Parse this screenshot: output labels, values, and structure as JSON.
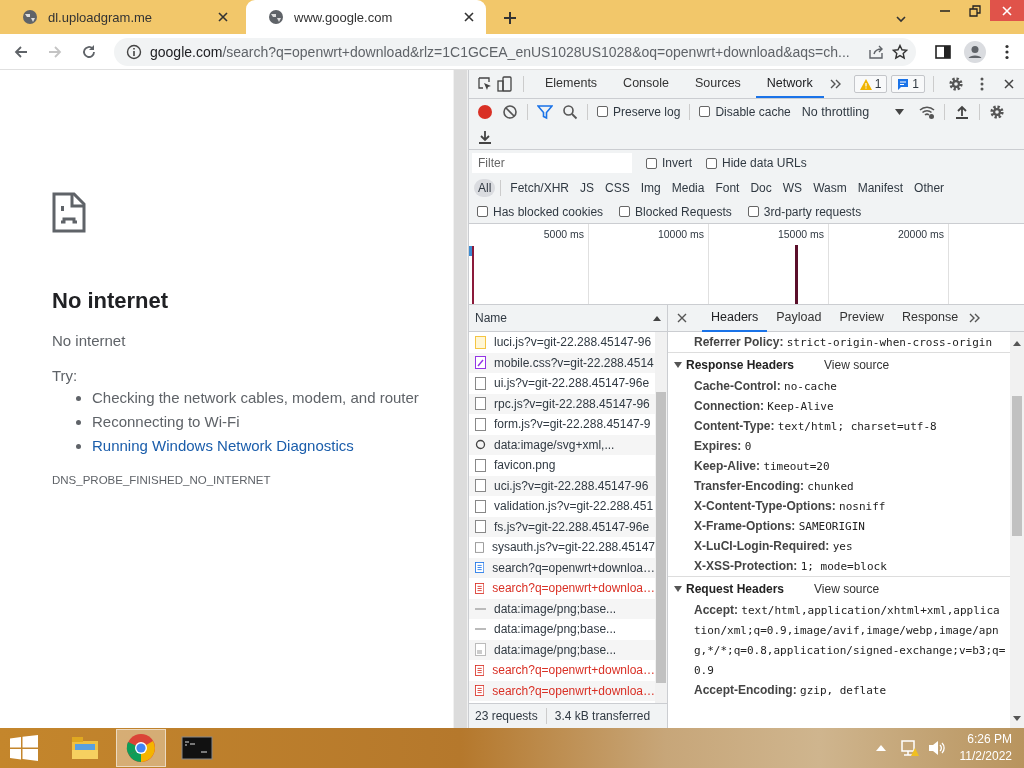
{
  "browser_tabs": [
    {
      "title": "dl.uploadgram.me",
      "selected": false
    },
    {
      "title": "www.google.com",
      "selected": true
    }
  ],
  "toolbar": {
    "nav": [
      {
        "kind": "back",
        "disabled": false
      },
      {
        "kind": "forward",
        "disabled": true
      },
      {
        "kind": "reload",
        "disabled": false
      }
    ],
    "address": {
      "host": "google.com",
      "path": "/search?q=openwrt+download&rlz=1C1GCEA_enUS1028US1028&oq=openwrt+download&aqs=ch..."
    }
  },
  "error_page": {
    "title": "No internet",
    "subtitle": "No internet",
    "try_label": "Try:",
    "suggestions": [
      {
        "kind": "text",
        "text": "Checking the network cables, modem, and router"
      },
      {
        "kind": "text",
        "text": "Reconnecting to Wi-Fi"
      },
      {
        "kind": "link",
        "text": "Running Windows Network Diagnostics"
      }
    ],
    "error_code": "DNS_PROBE_FINISHED_NO_INTERNET"
  },
  "devtools": {
    "tabs": [
      {
        "label": "Elements",
        "selected": false
      },
      {
        "label": "Console",
        "selected": false
      },
      {
        "label": "Sources",
        "selected": false
      },
      {
        "label": "Network",
        "selected": true
      }
    ],
    "warnings": "1",
    "messages": "1",
    "network_toolbar": {
      "recording": true,
      "preserve_log": {
        "label": "Preserve log",
        "checked": false
      },
      "disable_cache": {
        "label": "Disable cache",
        "checked": false
      },
      "throttling": "No throttling"
    },
    "filter": {
      "placeholder": "Filter",
      "options": [
        {
          "label": "Invert",
          "checked": false
        },
        {
          "label": "Hide data URLs",
          "checked": false
        }
      ]
    },
    "type_filters": [
      {
        "label": "All",
        "selected": true
      },
      {
        "label": "Fetch/XHR",
        "selected": false
      },
      {
        "label": "JS",
        "selected": false
      },
      {
        "label": "CSS",
        "selected": false
      },
      {
        "label": "Img",
        "selected": false
      },
      {
        "label": "Media",
        "selected": false
      },
      {
        "label": "Font",
        "selected": false
      },
      {
        "label": "Doc",
        "selected": false
      },
      {
        "label": "WS",
        "selected": false
      },
      {
        "label": "Wasm",
        "selected": false
      },
      {
        "label": "Manifest",
        "selected": false
      },
      {
        "label": "Other",
        "selected": false
      }
    ],
    "more_filters": [
      {
        "label": "Has blocked cookies",
        "checked": false
      },
      {
        "label": "Blocked Requests",
        "checked": false
      },
      {
        "label": "3rd-party requests",
        "checked": false
      }
    ],
    "timeline": {
      "ticks": [
        "5000 ms",
        "10000 ms",
        "15000 ms",
        "20000 ms"
      ]
    },
    "requests": {
      "column": "Name",
      "rows": [
        {
          "name": "luci.js?v=git-22.288.45147-96",
          "kind": "script",
          "error": false
        },
        {
          "name": "mobile.css?v=git-22.288.4514",
          "kind": "stylesheet",
          "error": false
        },
        {
          "name": "ui.js?v=git-22.288.45147-96e",
          "kind": "file",
          "error": false
        },
        {
          "name": "rpc.js?v=git-22.288.45147-96",
          "kind": "file",
          "error": false
        },
        {
          "name": "form.js?v=git-22.288.45147-9",
          "kind": "file",
          "error": false
        },
        {
          "name": "data:image/svg+xml,...",
          "kind": "svg",
          "error": false
        },
        {
          "name": "favicon.png",
          "kind": "file",
          "error": false
        },
        {
          "name": "uci.js?v=git-22.288.45147-96",
          "kind": "file",
          "error": false
        },
        {
          "name": "validation.js?v=git-22.288.451",
          "kind": "file",
          "error": false
        },
        {
          "name": "fs.js?v=git-22.288.45147-96e",
          "kind": "file",
          "error": false
        },
        {
          "name": "sysauth.js?v=git-22.288.45147",
          "kind": "file",
          "error": false
        },
        {
          "name": "search?q=openwrt+downloa…",
          "kind": "document",
          "error": false
        },
        {
          "name": "search?q=openwrt+downloa…",
          "kind": "document",
          "error": true
        },
        {
          "name": "data:image/png;base...",
          "kind": "pixel",
          "error": false
        },
        {
          "name": "data:image/png;base...",
          "kind": "pixel",
          "error": false
        },
        {
          "name": "data:image/png;base...",
          "kind": "image",
          "error": false
        },
        {
          "name": "search?q=openwrt+downloa…",
          "kind": "document",
          "error": true
        },
        {
          "name": "search?q=openwrt+downloa…",
          "kind": "document",
          "error": true
        }
      ],
      "summary": [
        "23 requests",
        "3.4 kB transferred"
      ]
    },
    "details": {
      "tabs": [
        {
          "label": "Headers",
          "selected": true
        },
        {
          "label": "Payload",
          "selected": false
        },
        {
          "label": "Preview",
          "selected": false
        },
        {
          "label": "Response",
          "selected": false
        }
      ],
      "top_line": {
        "name": "Referrer Policy:",
        "value": "strict-origin-when-cross-origin"
      },
      "sections": [
        {
          "title": "Response Headers",
          "expanded": true,
          "view_source": "View source",
          "headers": [
            {
              "name": "Cache-Control:",
              "value": "no-cache"
            },
            {
              "name": "Connection:",
              "value": "Keep-Alive"
            },
            {
              "name": "Content-Type:",
              "value": "text/html; charset=utf-8"
            },
            {
              "name": "Expires:",
              "value": "0"
            },
            {
              "name": "Keep-Alive:",
              "value": "timeout=20"
            },
            {
              "name": "Transfer-Encoding:",
              "value": "chunked"
            },
            {
              "name": "X-Content-Type-Options:",
              "value": "nosniff"
            },
            {
              "name": "X-Frame-Options:",
              "value": "SAMEORIGIN"
            },
            {
              "name": "X-LuCI-Login-Required:",
              "value": "yes"
            },
            {
              "name": "X-XSS-Protection:",
              "value": "1; mode=block"
            }
          ]
        },
        {
          "title": "Request Headers",
          "expanded": true,
          "view_source": "View source",
          "headers": [
            {
              "name": "Accept:",
              "value": "text/html,application/xhtml+xml,application/xml;q=0.9,image/avif,image/webp,image/apng,*/*;q=0.8,application/signed-exchange;v=b3;q=0.9"
            },
            {
              "name": "Accept-Encoding:",
              "value": "gzip, deflate"
            }
          ]
        }
      ]
    }
  },
  "taskbar": {
    "apps": [
      {
        "kind": "explorer",
        "active": false
      },
      {
        "kind": "chrome",
        "active": true
      },
      {
        "kind": "terminal",
        "active": false
      }
    ],
    "time": "6:26 PM",
    "date": "11/2/2022"
  }
}
